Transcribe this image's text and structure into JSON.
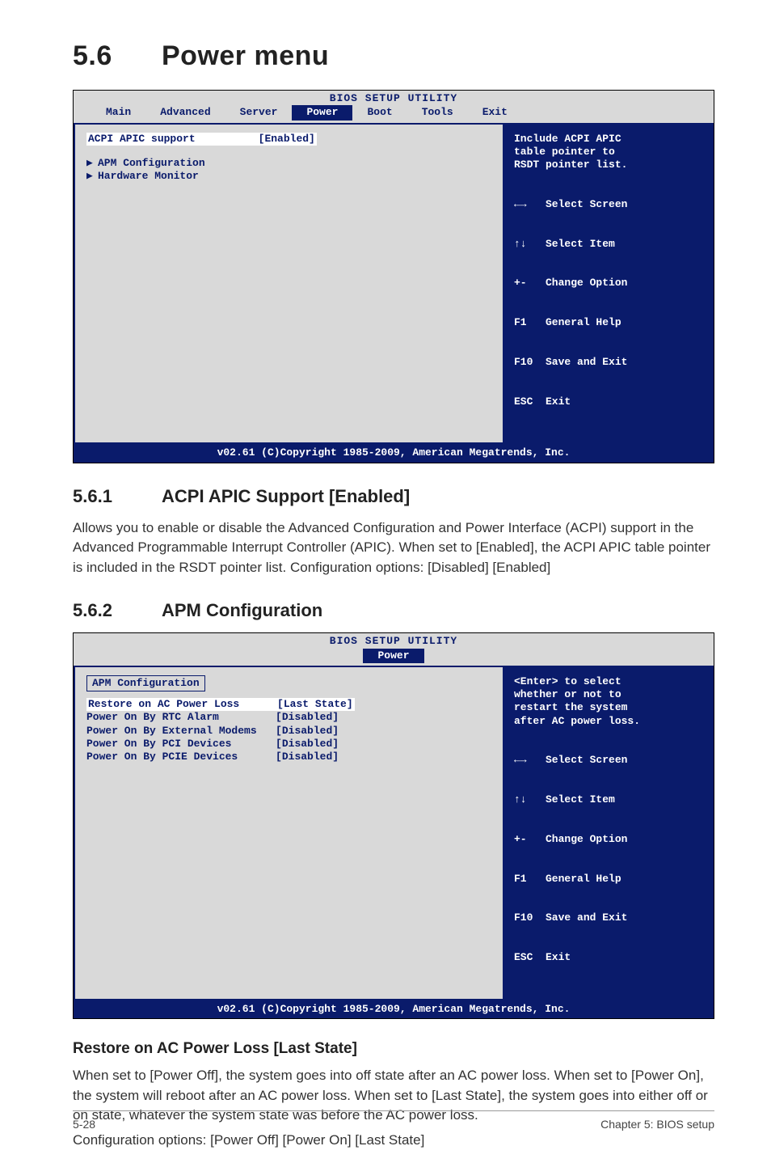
{
  "headings": {
    "h1_num": "5.6",
    "h1_title": "Power menu",
    "h2a_num": "5.6.1",
    "h2a_title": "ACPI APIC Support [Enabled]",
    "h2b_num": "5.6.2",
    "h2b_title": "APM Configuration",
    "h3_restore": "Restore on AC Power Loss [Last State]"
  },
  "paras": {
    "p561": "Allows you to enable or disable the Advanced Configuration and Power Interface (ACPI) support in the Advanced Programmable Interrupt Controller (APIC). When set to [Enabled], the ACPI APIC table pointer is included in the RSDT pointer list. Configuration options: [Disabled] [Enabled]",
    "p_restore_1": "When set to [Power Off], the system goes into off state after an AC power loss. When set to [Power On], the system will reboot after an AC power loss. When set to [Last State], the system goes into either off or on state, whatever the system state was before the AC power loss.",
    "p_restore_2": "Configuration options: [Power Off] [Power On] [Last State]"
  },
  "bios_common": {
    "title": "BIOS SETUP UTILITY",
    "footer": "v02.61 (C)Copyright 1985-2009, American Megatrends, Inc.",
    "keys_l1": "←→   Select Screen",
    "keys_l2": "↑↓   Select Item",
    "keys_l3": "+-   Change Option",
    "keys_l4": "F1   General Help",
    "keys_l5": "F10  Save and Exit",
    "keys_l6": "ESC  Exit"
  },
  "bios1": {
    "tabs": [
      "Main",
      "Advanced",
      "Server",
      "Power",
      "Boot",
      "Tools",
      "Exit"
    ],
    "active_tab": "Power",
    "row1_label": "ACPI APIC support",
    "row1_value": "[Enabled]",
    "sub1": "APM Configuration",
    "sub2": "Hardware Monitor",
    "help": "Include ACPI APIC\ntable pointer to\nRSDT pointer list."
  },
  "bios2": {
    "active_tab": "Power",
    "subtitle": "APM Configuration",
    "rows": [
      {
        "label": "Restore on AC Power Loss",
        "value": "[Last State]",
        "sel": true
      },
      {
        "label": "Power On By RTC Alarm",
        "value": "[Disabled]"
      },
      {
        "label": "Power On By External Modems",
        "value": "[Disabled]"
      },
      {
        "label": "Power On By PCI Devices",
        "value": "[Disabled]"
      },
      {
        "label": "Power On By PCIE Devices",
        "value": "[Disabled]"
      }
    ],
    "help": "<Enter> to select\nwhether or not to\nrestart the system\nafter AC power loss."
  },
  "footer": {
    "page": "5-28",
    "chapter": "Chapter 5: BIOS setup"
  },
  "chart_data": null
}
